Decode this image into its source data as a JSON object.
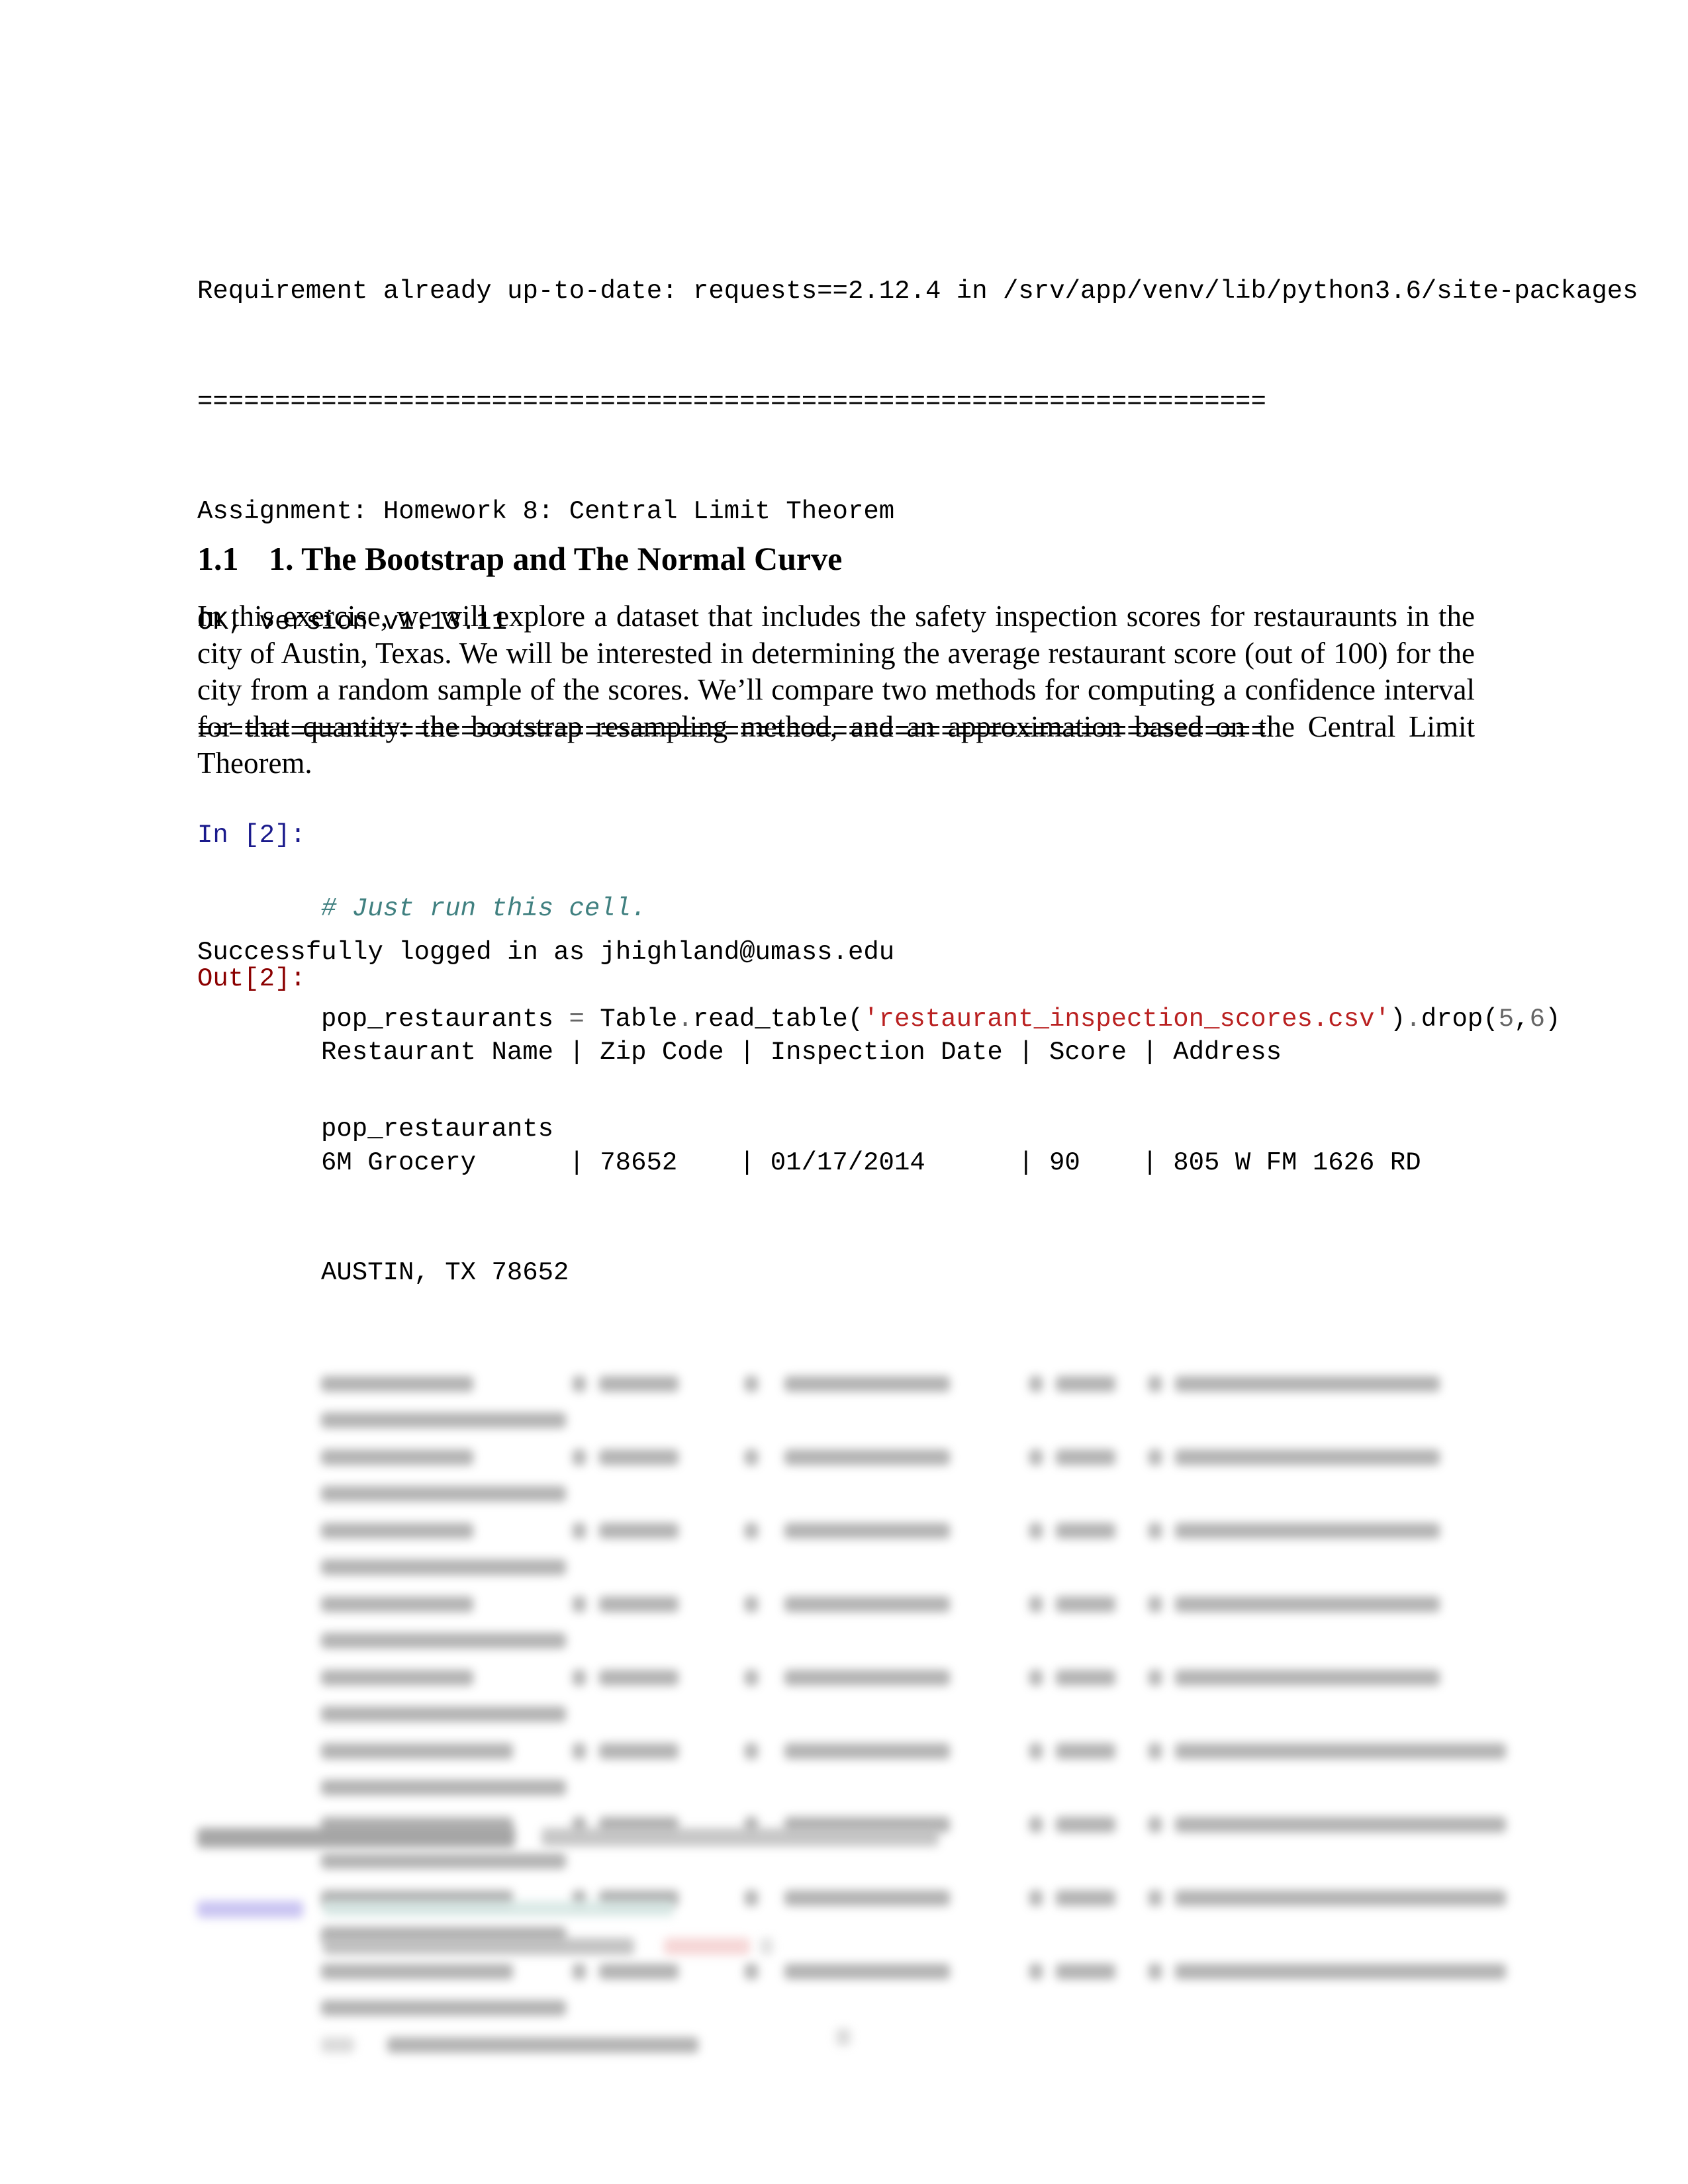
{
  "console_output": {
    "lines": [
      "Requirement already up-to-date: requests==2.12.4 in /srv/app/venv/lib/python3.6/site-packages",
      "=====================================================================",
      "Assignment: Homework 8: Central Limit Theorem",
      "OK, version v1.13.11",
      "=====================================================================",
      "",
      "Successfully logged in as jhighland@umass.edu"
    ]
  },
  "section": {
    "number": "1.1",
    "title": "1. The Bootstrap and The Normal Curve",
    "paragraph": "In this exercise, we will explore a dataset that includes the safety inspection scores for restauraunts in the city of Austin, Texas. We will be interested in determining the average restaurant score (out of 100) for the city from a random sample of the scores. We’ll compare two methods for computing a confidence interval for that quantity: the bootstrap resampling method, and an approximation based on the Central Limit Theorem."
  },
  "cell_in": {
    "prompt": "In [2]:",
    "comment": "# Just run this cell.",
    "code_var": "pop_restaurants",
    "code_eq": "=",
    "code_obj": "Table",
    "code_dot1": ".",
    "code_fn": "read_table(",
    "code_str": "'restaurant_inspection_scores.csv'",
    "code_close": ")",
    "code_dot2": ".",
    "code_drop": "drop(",
    "code_n1": "5",
    "code_comma": ",",
    "code_n2": "6",
    "code_end": ")",
    "line3": "pop_restaurants"
  },
  "cell_out": {
    "prompt": "Out[2]:",
    "header": "Restaurant Name | Zip Code | Inspection Date | Score | Address",
    "row1": "6M Grocery      | 78652    | 01/17/2014      | 90    | 805 W FM 1626 RD",
    "row1_cont": "AUSTIN, TX 78652"
  },
  "colors": {
    "in_prompt": "#1a1a8c",
    "out_prompt": "#8b0000",
    "comment": "#408080",
    "string": "#ba2121"
  }
}
